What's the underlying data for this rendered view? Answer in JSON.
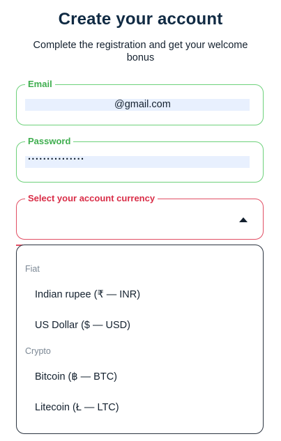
{
  "header": {
    "title": "Create your account",
    "subtitle": "Complete the registration and get your welcome bonus"
  },
  "form": {
    "email": {
      "label": "Email",
      "value": "@gmail.com"
    },
    "password": {
      "label": "Password",
      "value": "···············"
    },
    "currency": {
      "label": "Select your account currency",
      "value": ""
    }
  },
  "dropdown": {
    "groups": [
      {
        "label": "Fiat",
        "options": [
          "Indian rupee (₹ — INR)",
          "US Dollar ($ — USD)"
        ]
      },
      {
        "label": "Crypto",
        "options": [
          "Bitcoin (฿ — BTC)",
          "Litecoin (Ł — LTC)"
        ]
      }
    ]
  },
  "colors": {
    "valid_border": "#6dd17a",
    "valid_label": "#3fae4f",
    "error_border": "#e14e63",
    "error_label": "#d92d47",
    "autofill_bg": "#e8f0fe",
    "title": "#102a43"
  }
}
